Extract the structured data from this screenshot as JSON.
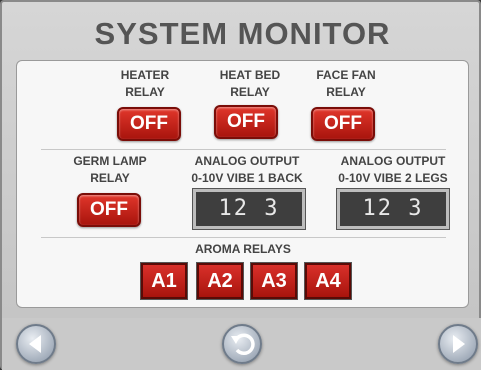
{
  "title": "SYSTEM MONITOR",
  "relays": {
    "heater": {
      "label_line1": "HEATER",
      "label_line2": "RELAY",
      "state": "OFF"
    },
    "heat_bed": {
      "label_line1": "HEAT BED",
      "label_line2": "RELAY",
      "state": "OFF"
    },
    "face_fan": {
      "label_line1": "FACE FAN",
      "label_line2": "RELAY",
      "state": "OFF"
    },
    "germ_lamp": {
      "label_line1": "GERM LAMP",
      "label_line2": "RELAY",
      "state": "OFF"
    }
  },
  "analog_outputs": [
    {
      "label_line1": "ANALOG OUTPUT",
      "label_line2": "0-10V VIBE 1 BACK",
      "value": "12 3"
    },
    {
      "label_line1": "ANALOG OUTPUT",
      "label_line2": "0-10V VIBE 2 LEGS",
      "value": "12 3"
    }
  ],
  "aroma": {
    "label": "AROMA RELAYS",
    "buttons": [
      "A1",
      "A2",
      "A3",
      "A4"
    ]
  },
  "nav": {
    "left": "left-arrow-icon",
    "center": "undo-icon",
    "right": "right-arrow-icon"
  },
  "colors": {
    "off_button": "#c8231b",
    "display_bg": "#3e3e3e",
    "nav_button": "#aab4c2"
  }
}
